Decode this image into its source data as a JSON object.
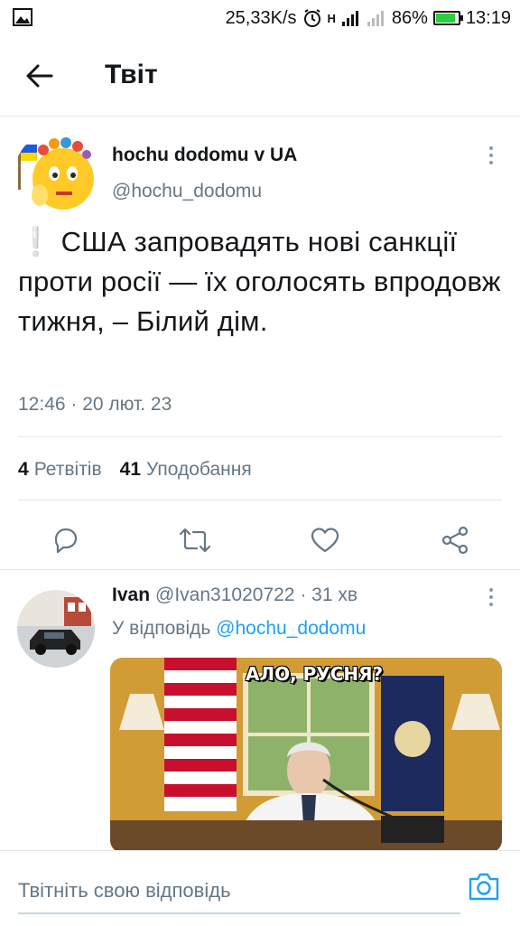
{
  "status_bar": {
    "speed": "25,33K/s",
    "network": "H",
    "battery": "86%",
    "battery_level": 0.86,
    "time": "13:19"
  },
  "app_bar": {
    "title": "Твіт"
  },
  "tweet": {
    "author_name": "hochu dodomu v UA",
    "author_handle": "@hochu_dodomu",
    "emoji": "❕",
    "text": "США запровадять нові санкції проти росії — їх оголосять впродовж тижня, – Білий дім.",
    "timestamp": "12:46 · 20 лют. 23",
    "retweet_count": "4",
    "retweet_label": "Ретвітів",
    "like_count": "41",
    "like_label": "Уподобання"
  },
  "reply": {
    "author_name": "Ivan",
    "author_handle": "@Ivan31020722",
    "time_ago": "· 31 хв",
    "reply_prefix": "У відповідь",
    "reply_to_handle": "@hochu_dodomu",
    "image_caption": "АЛО, РУСНЯ?"
  },
  "compose": {
    "placeholder": "Твітніть свою відповідь"
  },
  "colors": {
    "accent": "#1da1f2",
    "secondary_text": "#657786",
    "divider": "#e1e8ed"
  }
}
